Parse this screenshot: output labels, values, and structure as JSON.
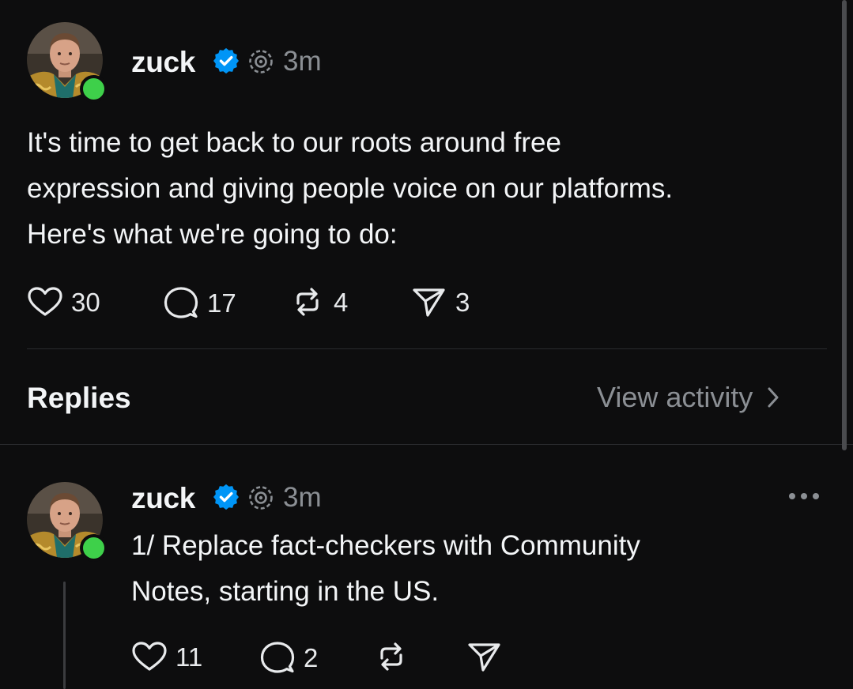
{
  "post": {
    "username": "zuck",
    "timestamp": "3m",
    "text_lines": [
      "It's time to get back to our roots around free",
      "expression and giving people voice on our platforms.",
      "Here's what we're going to do:"
    ],
    "likes": "30",
    "comments": "17",
    "reposts": "4",
    "shares": "3"
  },
  "replies_header": {
    "title": "Replies",
    "view_activity": "View activity"
  },
  "reply": {
    "username": "zuck",
    "timestamp": "3m",
    "text_lines": [
      "1/ Replace fact-checkers with Community",
      "Notes, starting in the US."
    ],
    "likes": "11",
    "comments": "2",
    "reposts": "",
    "shares": ""
  },
  "icons": {
    "verified": "verified-badge-icon",
    "threads": "threads-logo-icon",
    "like": "heart-icon",
    "comment": "comment-bubble-icon",
    "repost": "repost-icon",
    "share": "send-icon",
    "more": "more-dots-icon",
    "chevron": "chevron-right-icon"
  },
  "colors": {
    "background": "#0d0d0e",
    "verified_blue": "#0095f6",
    "online_green": "#3ed04a",
    "secondary_text": "#8b8f94"
  }
}
